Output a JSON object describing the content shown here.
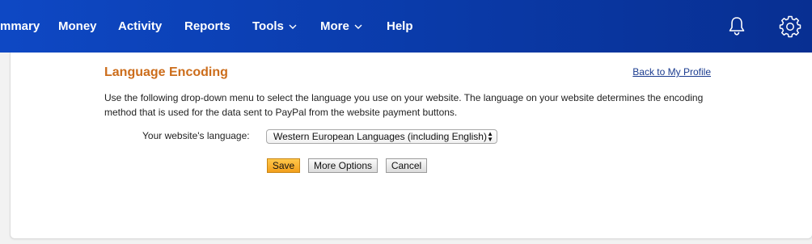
{
  "nav": {
    "items": [
      {
        "label": "mmary"
      },
      {
        "label": "Money"
      },
      {
        "label": "Activity"
      },
      {
        "label": "Reports"
      },
      {
        "label": "Tools"
      },
      {
        "label": "More"
      },
      {
        "label": "Help"
      }
    ],
    "icons": {
      "notifications": "bell-icon",
      "settings": "gear-icon"
    },
    "colors": {
      "bar": "#0e48c4",
      "text": "#ffffff"
    }
  },
  "page": {
    "title": "Language Encoding",
    "back_link": "Back to My Profile",
    "description": "Use the following drop-down menu to select the language you use on your website. The language on your website determines the encoding method that is used for the data sent to PayPal from the website payment buttons.",
    "language_label": "Your website's language:",
    "language_selected": "Western European Languages (including English)",
    "title_color": "#cc6d1b"
  },
  "buttons": {
    "save": "Save",
    "more_options": "More Options",
    "cancel": "Cancel"
  }
}
